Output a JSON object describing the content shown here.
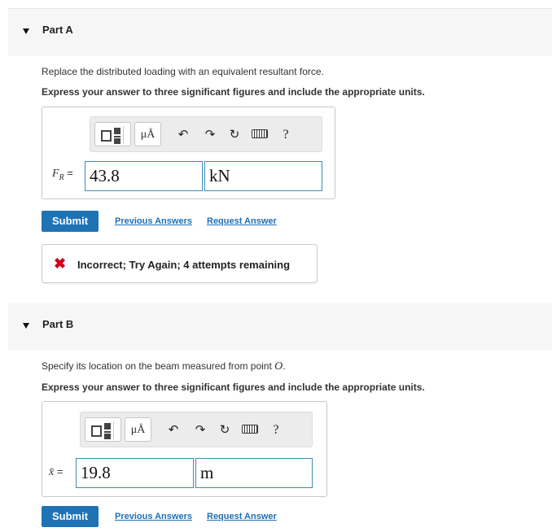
{
  "partA": {
    "title": "Part A",
    "question": "Replace the distributed loading with an equivalent resultant force.",
    "instruction": "Express your answer to three significant figures and include the appropriate units.",
    "toolbar": {
      "template_icon": "fraction-template-icon",
      "units_label": "μÅ",
      "undo_icon": "↶",
      "redo_icon": "↷",
      "reset_icon": "↻",
      "keyboard_icon": "keyboard-icon",
      "help_label": "?"
    },
    "variable": "F",
    "variable_sub": "R",
    "equals": "=",
    "value": "43.8",
    "unit": "kN",
    "submit_label": "Submit",
    "previous_answers": "Previous Answers",
    "request_answer": "Request Answer",
    "feedback": {
      "icon": "✖",
      "text": "Incorrect; Try Again; 4 attempts remaining"
    }
  },
  "partB": {
    "title": "Part B",
    "question_prefix": "Specify its location on the beam measured from point ",
    "question_point": "O",
    "question_suffix": ".",
    "instruction": "Express your answer to three significant figures and include the appropriate units.",
    "toolbar": {
      "template_icon": "fraction-template-icon",
      "units_label": "μÅ",
      "undo_icon": "↶",
      "redo_icon": "↷",
      "reset_icon": "↻",
      "keyboard_icon": "keyboard-icon",
      "help_label": "?"
    },
    "variable": "x̄",
    "equals": "=",
    "value": "19.8",
    "unit": "m",
    "submit_label": "Submit",
    "previous_answers": "Previous Answers",
    "request_answer": "Request Answer"
  },
  "colors": {
    "submit_bg": "#1e73b5",
    "link": "#1e6fb5",
    "field_border": "#3c8db8",
    "error": "#d0021b",
    "header_bg": "#f6f6f6"
  }
}
